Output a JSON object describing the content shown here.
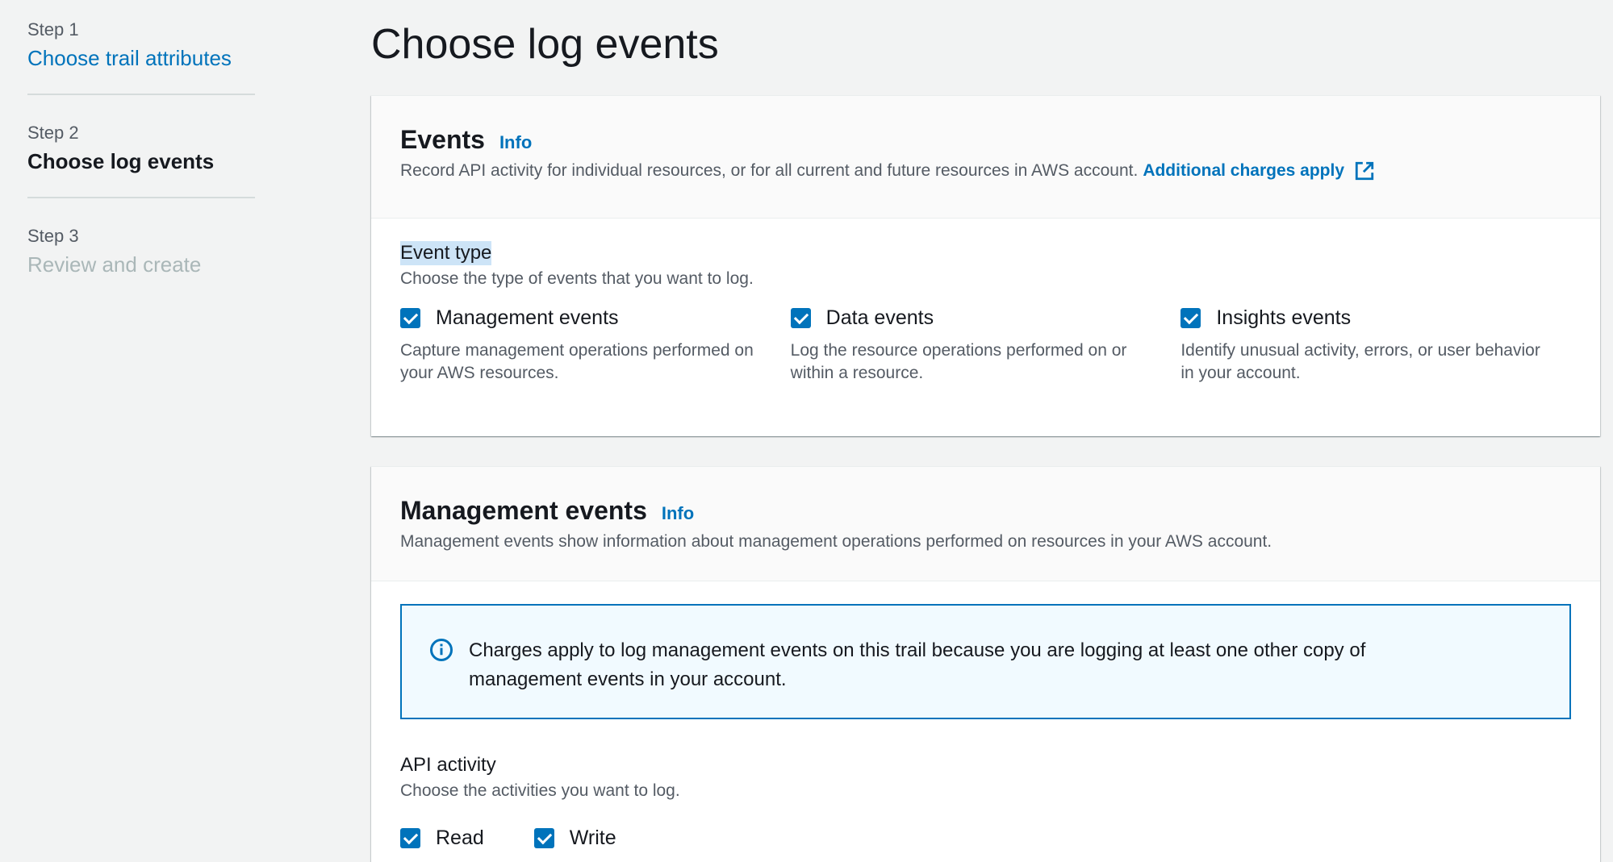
{
  "steps": [
    {
      "step": "Step 1",
      "title": "Choose trail attributes",
      "state": "link"
    },
    {
      "step": "Step 2",
      "title": "Choose log events",
      "state": "active"
    },
    {
      "step": "Step 3",
      "title": "Review and create",
      "state": "disabled"
    }
  ],
  "page": {
    "title": "Choose log events"
  },
  "events": {
    "heading": "Events",
    "info": "Info",
    "description": "Record API activity for individual resources, or for all current and future resources in AWS account.",
    "charges_link": "Additional charges apply",
    "event_type": {
      "label": "Event type",
      "description": "Choose the type of events that you want to log.",
      "options": [
        {
          "label": "Management events",
          "checked": true,
          "description": "Capture management operations performed on your AWS resources."
        },
        {
          "label": "Data events",
          "checked": true,
          "description": "Log the resource operations performed on or within a resource."
        },
        {
          "label": "Insights events",
          "checked": true,
          "description": "Identify unusual activity, errors, or user behavior in your account."
        }
      ]
    }
  },
  "management": {
    "heading": "Management events",
    "info": "Info",
    "description": "Management events show information about management operations performed on resources in your AWS account.",
    "alert": "Charges apply to log management events on this trail because you are logging at least one other copy of management events in your account.",
    "api_activity": {
      "label": "API activity",
      "description": "Choose the activities you want to log.",
      "options": [
        {
          "label": "Read",
          "checked": true
        },
        {
          "label": "Write",
          "checked": true
        }
      ]
    }
  },
  "colors": {
    "link": "#0073bb",
    "background": "#f2f3f3",
    "alert_bg": "#f1faff",
    "highlight": "#cde4f7"
  },
  "icons": {
    "external": "external-link-icon",
    "info": "info-circle-icon",
    "checkbox": "checkmark-icon"
  }
}
